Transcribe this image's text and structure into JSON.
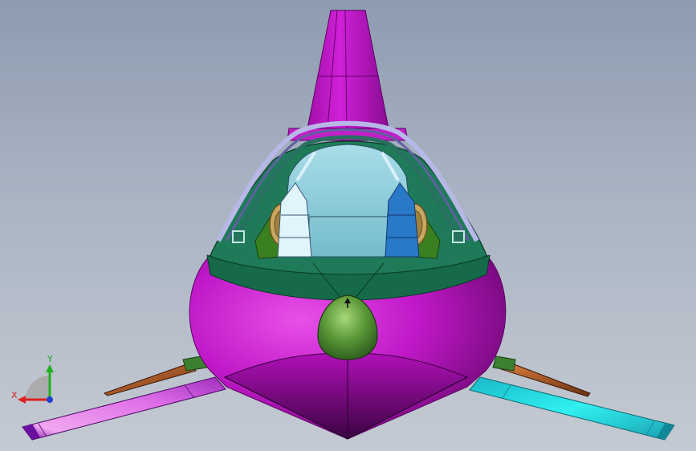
{
  "viewport": {
    "axes": {
      "x": "X",
      "y": "Y"
    },
    "colors": {
      "body": "#c418c4",
      "collar": "#1e7a58",
      "canopy": "#88c8d6",
      "left_boom": "#d878e0",
      "right_boom": "#28e0e0",
      "axis_x": "#e02020",
      "axis_y": "#20b020",
      "axis_z": "#2040d0"
    }
  }
}
